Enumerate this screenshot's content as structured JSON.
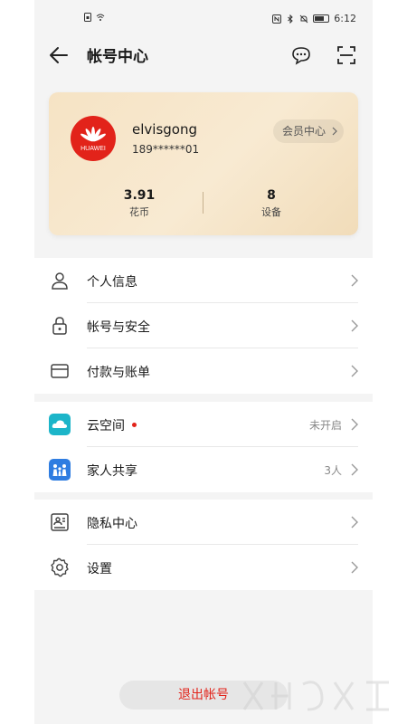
{
  "status_bar": {
    "time": "6:12"
  },
  "header": {
    "title": "帐号中心",
    "icons": [
      "back-arrow-icon",
      "message-icon",
      "scan-icon"
    ]
  },
  "profile": {
    "username": "elvisgong",
    "phone": "189******01",
    "logo_text": "HUAWEI",
    "member_center": "会员中心",
    "stats": [
      {
        "value": "3.91",
        "label": "花币"
      },
      {
        "value": "8",
        "label": "设备"
      }
    ]
  },
  "menu_group_1": [
    {
      "label": "个人信息",
      "icon": "person-icon"
    },
    {
      "label": "帐号与安全",
      "icon": "lock-icon"
    },
    {
      "label": "付款与账单",
      "icon": "card-icon"
    }
  ],
  "menu_group_2": [
    {
      "label": "云空间",
      "right": "未开启",
      "icon": "cloud-icon",
      "has_dot": true
    },
    {
      "label": "家人共享",
      "right": "3人",
      "icon": "family-icon"
    }
  ],
  "menu_group_3": [
    {
      "label": "隐私中心",
      "icon": "privacy-icon"
    },
    {
      "label": "设置",
      "icon": "gear-icon"
    }
  ],
  "logout": {
    "label": "退出帐号"
  },
  "colors": {
    "brand_red": "#e2231a",
    "card_gold": "#f6e3c4",
    "background": "#f4f4f4"
  }
}
